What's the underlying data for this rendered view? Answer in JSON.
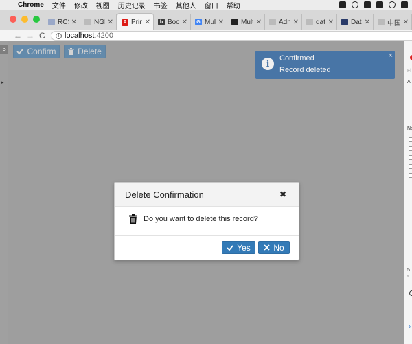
{
  "menubar": {
    "apple": "",
    "app": "Chrome",
    "items": [
      "文件",
      "修改",
      "视图",
      "历史记录",
      "书签",
      "其他人",
      "窗口",
      "帮助"
    ]
  },
  "tabs": [
    {
      "title": "RCS",
      "icon_color": "#9aa8c8",
      "icon_text": "",
      "active": false
    },
    {
      "title": "NGL",
      "icon_color": "#bbbbbb",
      "icon_text": "",
      "active": false
    },
    {
      "title": "Prime",
      "icon_color": "#dd1b16",
      "icon_text": "A",
      "active": true
    },
    {
      "title": "Boots",
      "icon_color": "#3c3c3c",
      "icon_text": "b",
      "active": false
    },
    {
      "title": "Multi",
      "icon_color": "#4285f4",
      "icon_text": "G",
      "active": false
    },
    {
      "title": "Multi",
      "icon_color": "#222222",
      "icon_text": "",
      "active": false
    },
    {
      "title": "Admi",
      "icon_color": "#bbbbbb",
      "icon_text": "",
      "active": false
    },
    {
      "title": "data.",
      "icon_color": "#bbbbbb",
      "icon_text": "",
      "active": false
    },
    {
      "title": "Data",
      "icon_color": "#2a3b6a",
      "icon_text": "",
      "active": false
    },
    {
      "title": "中国",
      "icon_color": "#bbbbbb",
      "icon_text": "",
      "active": false
    }
  ],
  "tab_close": "✕",
  "address": {
    "host": "localhost",
    "port": ":4200",
    "back": "←",
    "forward": "→",
    "reload": "C"
  },
  "gutter": {
    "label_a": "B",
    "label_b": "▸"
  },
  "toolbar": {
    "confirm_label": "Confirm",
    "delete_label": "Delete"
  },
  "toast": {
    "title": "Confirmed",
    "detail": "Record deleted",
    "close": "×"
  },
  "dialog": {
    "title": "Delete Confirmation",
    "close": "✖",
    "message": "Do you want to delete this record?",
    "yes_label": "Yes",
    "no_label": "No"
  },
  "devtools": {
    "text1": "Fi",
    "text2": "Al",
    "text3": "Na",
    "text4": "5 ,",
    "text5": "›"
  },
  "colors": {
    "primary": "#337ab7",
    "overlay": "#9e9e9e",
    "toast": "#3a6ea8"
  }
}
